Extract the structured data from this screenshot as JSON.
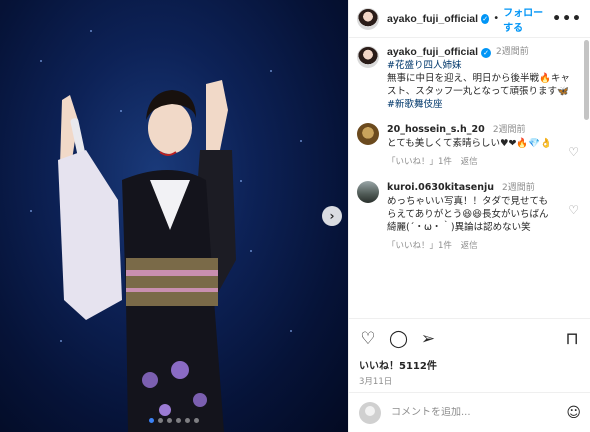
{
  "post": {
    "username": "ayako_fuji_official",
    "follow_label": "フォローする",
    "separator": "•",
    "more_label": "•••",
    "caption": {
      "time": "2週間前",
      "tag1": "#花盛り四人姉妹",
      "text": "無事に中日を迎え、明日から後半戦🔥キャスト、スタッフ一丸となって頑張ります🦋",
      "tag2": "#新歌舞伎座"
    }
  },
  "comments": [
    {
      "username": "20_hossein_s.h_20",
      "time": "2週間前",
      "text": "とても美しくて素晴らしい♥❤🔥💎👌",
      "like_label": "「いいね！」1件",
      "reply_label": "返信"
    },
    {
      "username": "kuroi.0630kitasenju",
      "time": "2週間前",
      "text": "めっちゃいい写真！！タダで見せてもらえてありがとう😆😆長女がいちばん綺麗(´・ω・｀)異論は認めない笑",
      "like_label": "「いいね！」1件",
      "reply_label": "返信"
    }
  ],
  "actions": {
    "likes": "いいね！5112件",
    "date": "3月11日"
  },
  "compose": {
    "placeholder": "コメントを追加..."
  },
  "icons": {
    "next": "chevron-right-icon",
    "like": "heart-icon",
    "comment": "comment-icon",
    "share": "share-icon",
    "save": "bookmark-icon",
    "emoji": "emoji-icon"
  },
  "colors": {
    "accent": "#0095f6",
    "carousel_active": "#3b82f6"
  }
}
